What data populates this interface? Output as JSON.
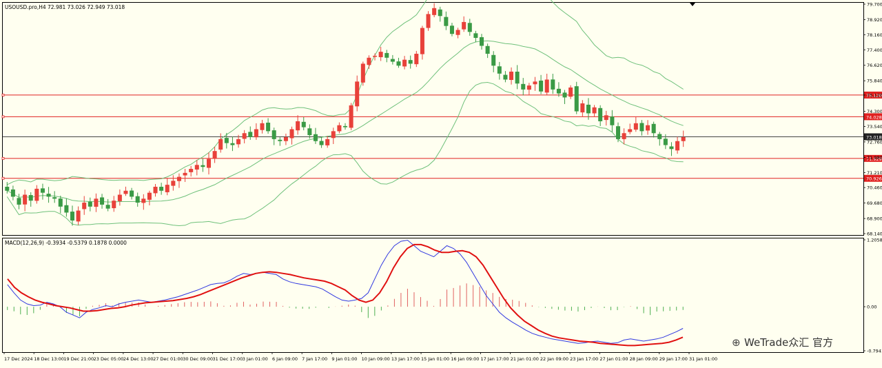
{
  "header": {
    "symbol_line": "USOUSD.pro,H4 72.981 73.026 72.949 73.018"
  },
  "indicator": {
    "label": "MACD(12,26,9) -0.3934 -0.5379 0.1878 0.0000"
  },
  "watermark": "WeTrade众汇 官方",
  "colors": {
    "background": "#fffff0",
    "bull_candle": "#e8413a",
    "bear_candle": "#3a9a45",
    "bollinger": "#6ec07a",
    "level_line": "#e02020",
    "current_price_line": "#444444",
    "macd_line": "#2f37e0",
    "signal_line": "#e01010",
    "hist_pos": "#e06060",
    "hist_neg": "#4caf50"
  },
  "chart_data": [
    {
      "type": "candlestick",
      "symbol": "USOUSD.pro",
      "timeframe": "H4",
      "ohlc_last": {
        "open": 72.981,
        "high": 73.026,
        "low": 72.949,
        "close": 73.018
      },
      "y_ticks": [
        "79.700",
        "78.920",
        "78.160",
        "77.400",
        "76.620",
        "75.840",
        "75.120",
        "74.300",
        "73.540",
        "72.760",
        "71.980",
        "71.210",
        "70.460",
        "69.680",
        "68.900",
        "68.140"
      ],
      "ylim": [
        68.14,
        79.7
      ],
      "current_price": "73.018",
      "horizontal_levels": [
        "75.120",
        "74.028",
        "71.929",
        "70.926"
      ],
      "x_tick_labels": [
        "17 Dec 2024",
        "18 Dec 13:00",
        "19 Dec 21:00",
        "23 Dec 05:00",
        "24 Dec 13:00",
        "27 Dec 01:00",
        "30 Dec 09:00",
        "31 Dec 17:00",
        "3 Jan 01:00",
        "6 Jan 09:00",
        "7 Jan 17:00",
        "9 Jan 01:00",
        "10 Jan 09:00",
        "13 Jan 17:00",
        "15 Jan 01:00",
        "16 Jan 09:00",
        "17 Jan 17:00",
        "21 Jan 01:00",
        "22 Jan 09:00",
        "23 Jan 17:00",
        "27 Jan 01:00",
        "28 Jan 09:00",
        "29 Jan 17:00",
        "31 Jan 01:00"
      ],
      "close_path": [
        70.3,
        70.0,
        69.6,
        70.1,
        69.8,
        70.4,
        70.2,
        70.0,
        69.9,
        69.5,
        69.2,
        68.8,
        69.3,
        69.7,
        69.5,
        69.9,
        69.6,
        69.4,
        69.8,
        70.1,
        70.3,
        70.0,
        69.7,
        69.9,
        70.2,
        70.5,
        70.3,
        70.6,
        70.8,
        71.0,
        71.2,
        71.4,
        71.6,
        71.5,
        71.9,
        72.3,
        72.9,
        72.7,
        72.6,
        72.9,
        73.2,
        73.0,
        73.4,
        73.7,
        73.3,
        72.9,
        72.8,
        73.0,
        73.4,
        73.8,
        73.5,
        73.1,
        72.8,
        72.6,
        72.9,
        73.3,
        73.6,
        73.5,
        74.6,
        75.8,
        76.7,
        77.0,
        77.1,
        77.3,
        77.0,
        76.8,
        76.6,
        76.9,
        76.7,
        77.2,
        78.5,
        79.2,
        79.5,
        79.1,
        78.6,
        78.2,
        78.4,
        78.8,
        78.3,
        78.0,
        77.6,
        77.2,
        76.6,
        76.2,
        75.9,
        76.3,
        75.7,
        75.4,
        75.6,
        75.8,
        75.3,
        75.9,
        75.4,
        75.2,
        75.0,
        75.5,
        74.3,
        74.7,
        74.2,
        74.5,
        73.8,
        74.1,
        73.6,
        72.9,
        73.2,
        73.4,
        73.7,
        73.3,
        73.6,
        73.2,
        72.9,
        72.6,
        72.4,
        72.8,
        73.0
      ]
    },
    {
      "type": "line",
      "name": "MACD(12,26,9)",
      "values_label": {
        "main": "-0.3934",
        "signal": "-0.5379",
        "histogram": "0.1878"
      },
      "y_ticks": [
        "1.2058",
        "0.00",
        "-0.7941"
      ],
      "ylim": [
        -0.7941,
        1.2058
      ],
      "macd": [
        0.4,
        0.25,
        0.12,
        0.05,
        0.02,
        0.03,
        0.08,
        0.05,
        0.0,
        -0.1,
        -0.15,
        -0.2,
        -0.1,
        -0.05,
        -0.02,
        0.02,
        0.0,
        0.05,
        0.08,
        0.1,
        0.12,
        0.1,
        0.08,
        0.1,
        0.12,
        0.15,
        0.18,
        0.22,
        0.26,
        0.3,
        0.35,
        0.4,
        0.42,
        0.43,
        0.48,
        0.55,
        0.6,
        0.58,
        0.6,
        0.62,
        0.6,
        0.58,
        0.5,
        0.45,
        0.42,
        0.4,
        0.38,
        0.36,
        0.32,
        0.25,
        0.18,
        0.12,
        0.1,
        0.12,
        0.15,
        0.25,
        0.5,
        0.75,
        0.95,
        1.1,
        1.18,
        1.2,
        1.1,
        1.0,
        0.95,
        0.9,
        1.0,
        1.1,
        1.05,
        0.95,
        0.8,
        0.6,
        0.4,
        0.2,
        0.05,
        -0.1,
        -0.2,
        -0.28,
        -0.35,
        -0.42,
        -0.48,
        -0.52,
        -0.55,
        -0.58,
        -0.6,
        -0.62,
        -0.64,
        -0.66,
        -0.65,
        -0.63,
        -0.62,
        -0.64,
        -0.66,
        -0.65,
        -0.6,
        -0.58,
        -0.6,
        -0.62,
        -0.6,
        -0.58,
        -0.55,
        -0.5,
        -0.45,
        -0.39
      ],
      "signal": [
        0.5,
        0.35,
        0.25,
        0.18,
        0.12,
        0.08,
        0.05,
        0.02,
        0.0,
        -0.02,
        -0.05,
        -0.08,
        -0.08,
        -0.07,
        -0.05,
        -0.03,
        -0.02,
        0.0,
        0.03,
        0.05,
        0.07,
        0.08,
        0.09,
        0.1,
        0.11,
        0.13,
        0.15,
        0.18,
        0.22,
        0.27,
        0.32,
        0.37,
        0.42,
        0.47,
        0.52,
        0.56,
        0.6,
        0.62,
        0.63,
        0.62,
        0.6,
        0.58,
        0.55,
        0.52,
        0.5,
        0.48,
        0.46,
        0.42,
        0.36,
        0.3,
        0.2,
        0.12,
        0.08,
        0.12,
        0.25,
        0.45,
        0.7,
        0.9,
        1.05,
        1.12,
        1.12,
        1.08,
        1.02,
        0.98,
        0.98,
        1.0,
        1.01,
        0.98,
        0.9,
        0.75,
        0.55,
        0.35,
        0.15,
        -0.02,
        -0.15,
        -0.26,
        -0.34,
        -0.42,
        -0.48,
        -0.53,
        -0.56,
        -0.58,
        -0.6,
        -0.62,
        -0.63,
        -0.64,
        -0.66,
        -0.67,
        -0.68,
        -0.69,
        -0.7,
        -0.7,
        -0.69,
        -0.68,
        -0.67,
        -0.66,
        -0.64,
        -0.6,
        -0.55
      ]
    }
  ]
}
